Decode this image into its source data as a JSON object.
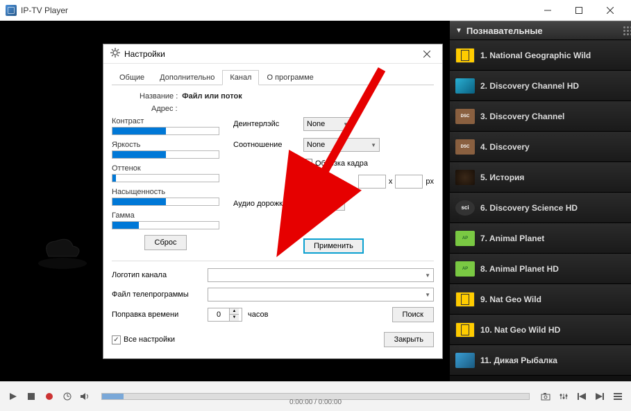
{
  "app": {
    "title": "IP-TV Player"
  },
  "sidebar": {
    "header": "Познавательные",
    "items": [
      {
        "label": "1. National Geographic Wild",
        "logo": "natgeo"
      },
      {
        "label": "2. Discovery Channel HD",
        "logo": "disc"
      },
      {
        "label": "3. Discovery Channel",
        "logo": "disctxt"
      },
      {
        "label": "4. Discovery",
        "logo": "disctxt"
      },
      {
        "label": "5. История",
        "logo": "hist"
      },
      {
        "label": "6. Discovery Science HD",
        "logo": "sci"
      },
      {
        "label": "7. Animal Planet",
        "logo": "ap"
      },
      {
        "label": "8. Animal Planet HD",
        "logo": "ap"
      },
      {
        "label": "9. Nat Geo Wild",
        "logo": "natgeo"
      },
      {
        "label": "10. Nat Geo Wild HD",
        "logo": "natgeo"
      },
      {
        "label": "11. Дикая Рыбалка",
        "logo": "fish"
      }
    ]
  },
  "controls": {
    "time": "0:00:00 / 0:00:00"
  },
  "dialog": {
    "title": "Настройки",
    "tabs": [
      "Общие",
      "Дополнительно",
      "Канал",
      "О программе"
    ],
    "active_tab": 2,
    "name_label": "Название :",
    "name_value": "Файл или поток",
    "addr_label": "Адрес :",
    "sliders": {
      "contrast": "Контраст",
      "brightness": "Яркость",
      "hue": "Оттенок",
      "saturation": "Насыщенность",
      "gamma": "Гамма"
    },
    "deinterlace_label": "Деинтерлэйс",
    "ratio_label": "Соотношение",
    "crop_label": "Обрезка кадра",
    "px_x": "x",
    "px_suffix": "px",
    "audio_track_label": "Аудио дорожка",
    "none_value": "None",
    "reset_btn": "Сброс",
    "apply_btn": "Применить",
    "logo_label": "Логотип канала",
    "epg_label": "Файл телепрограммы",
    "time_offset_label": "Поправка времени",
    "time_offset_value": "0",
    "hours_label": "часов",
    "search_btn": "Поиск",
    "all_settings": "Все настройки",
    "close_btn": "Закрыть"
  }
}
